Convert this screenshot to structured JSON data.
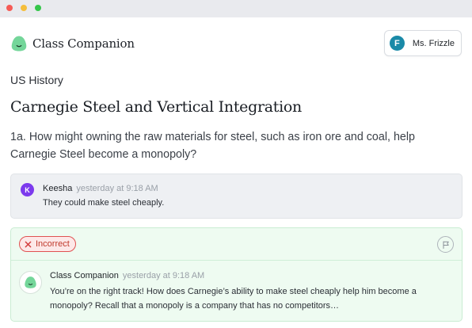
{
  "window": {
    "controls": [
      "close",
      "minimize",
      "zoom"
    ]
  },
  "header": {
    "brand_name": "Class Companion",
    "logo_icon": "class-companion-logo-icon",
    "brand_color": "#74d69a",
    "user": {
      "initial": "F",
      "name": "Ms. Frizzle",
      "avatar_color": "#1a8aa8"
    }
  },
  "page": {
    "subject": "US History",
    "lesson_title": "Carnegie Steel and Vertical Integration",
    "question": "1a. How might owning the raw materials for steel, such as iron ore and coal, help Carnegie Steel become a monopoly?"
  },
  "student_response": {
    "initial": "K",
    "avatar_color": "#7c3aed",
    "name": "Keesha",
    "timestamp": "yesterday at 9:18 AM",
    "text": "They could make steel cheaply."
  },
  "feedback": {
    "status_label": "Incorrect",
    "status_icon": "x-icon",
    "status_color": "#e05252",
    "flag_icon": "flag-icon",
    "author": "Class Companion",
    "timestamp": "yesterday at 9:18 AM",
    "text": "You’re on the right track! How does Carnegie’s ability to make steel cheaply help him become a monopoly? Recall that a monopoly is a company that has no competitors…"
  }
}
